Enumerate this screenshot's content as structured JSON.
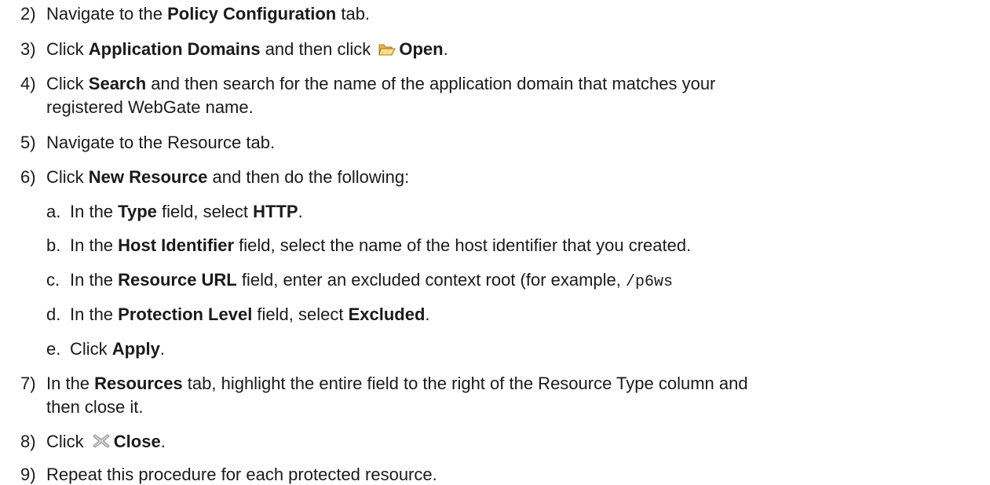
{
  "steps": [
    {
      "num": "2)",
      "pre": "Navigate to the ",
      "b1": "Policy Configuration",
      "post": " tab."
    },
    {
      "num": "3)",
      "pre": "Click ",
      "b1": "Application Domains",
      "mid": " and then click ",
      "icon": "folder-open-icon",
      "b2": "Open",
      "post": "."
    },
    {
      "num": "4)",
      "pre": "Click ",
      "b1": "Search",
      "post": " and then search for the name of the application domain that matches your",
      "cont": "registered WebGate name."
    },
    {
      "num": "5)",
      "pre": "Navigate to the Resource tab."
    },
    {
      "num": "6)",
      "pre": "Click ",
      "b1": "New Resource",
      "post": " and then do the following:"
    },
    {
      "num": "a.",
      "pre": "In the ",
      "b1": "Type",
      "mid": " field, select ",
      "b2": "HTTP",
      "post": "."
    },
    {
      "num": "b.",
      "pre": "In the ",
      "b1": "Host Identifier",
      "post": " field, select the name of the host identifier that you created."
    },
    {
      "num": "c.",
      "pre": "In the ",
      "b1": "Resource URL",
      "post": " field, enter an excluded context root (for example, ",
      "code": "/p6ws"
    },
    {
      "num": "d.",
      "pre": "In the ",
      "b1": "Protection Level",
      "mid": " field, select ",
      "b2": "Excluded",
      "post": "."
    },
    {
      "num": "e.",
      "pre": "Click ",
      "b1": "Apply",
      "post": "."
    },
    {
      "num": "7)",
      "pre": "In the ",
      "b1": "Resources",
      "post": " tab, highlight the entire field to the right of the Resource Type column and",
      "cont": "then close it."
    },
    {
      "num": "8)",
      "pre": "Click ",
      "icon": "close-x-icon",
      "b1": "Close",
      "post": "."
    },
    {
      "num": "9)",
      "pre": "Repeat this procedure for each protected resource."
    }
  ]
}
